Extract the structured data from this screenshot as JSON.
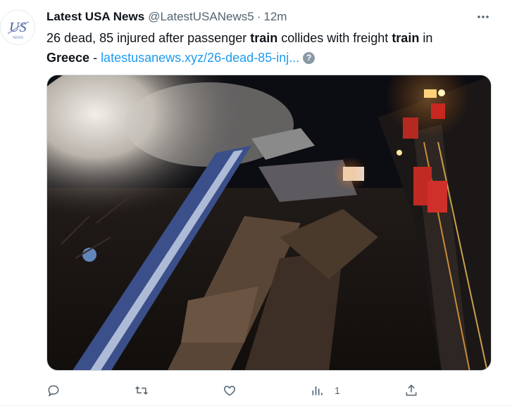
{
  "tweet": {
    "author_name": "Latest USA News",
    "author_handle": "@LatestUSANews5",
    "separator": "·",
    "timestamp": "12m",
    "text_parts": {
      "p1": "26 dead, 85 injured after passenger ",
      "kw1": "train",
      "p2": " collides with freight ",
      "kw2": "train",
      "p3": " in",
      "kw3": "Greece",
      "p4": " - ",
      "link": "latestusanews.xyz/26-dead-85-inj..."
    },
    "help_glyph": "?",
    "avatar_letters": "US",
    "avatar_caption": "NEWS"
  },
  "actions": {
    "reply_count": "",
    "retweet_count": "",
    "like_count": "",
    "views_count": "1"
  },
  "icons": {
    "more": "more-dots-icon",
    "reply": "reply-icon",
    "retweet": "retweet-icon",
    "like": "like-icon",
    "views": "views-icon",
    "share": "share-icon",
    "help": "help-icon"
  },
  "colors": {
    "text": "#0f1419",
    "secondary": "#536471",
    "link": "#1d9bf0"
  }
}
